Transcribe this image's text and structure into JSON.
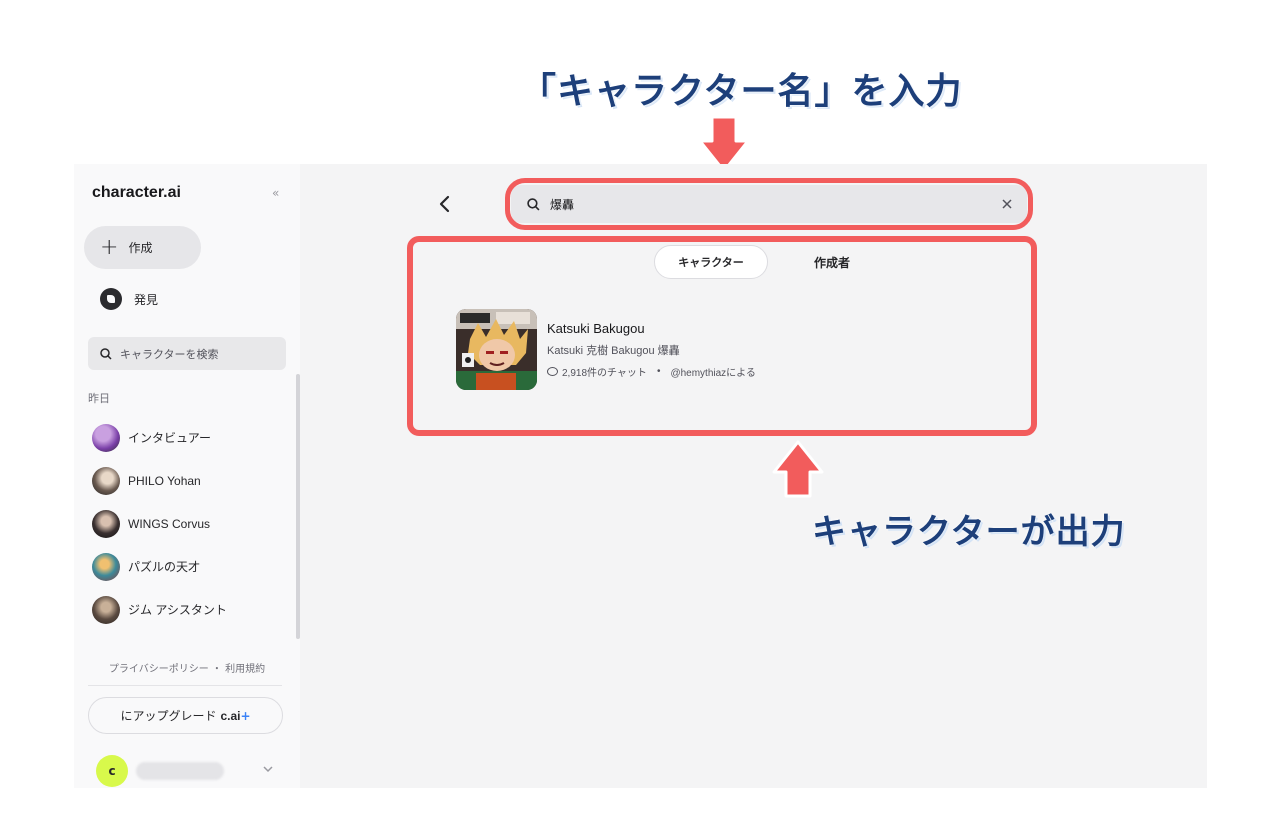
{
  "annotations": {
    "title": "「キャラクター名」を入力",
    "bottom": "キャラクターが出力"
  },
  "sidebar": {
    "logo": "character.ai",
    "collapse_icon": "«",
    "create_label": "作成",
    "discover_label": "発見",
    "search_placeholder": "キャラクターを検索",
    "section_label": "昨日",
    "chats": [
      {
        "name": "インタビュアー"
      },
      {
        "name": "PHILO Yohan"
      },
      {
        "name": "WINGS Corvus"
      },
      {
        "name": "パズルの天才"
      },
      {
        "name": "ジム アシスタント"
      }
    ],
    "footer": "プライバシーポリシー ・ 利用規約",
    "upgrade_prefix": "にアップグレード",
    "upgrade_brand": "c.ai",
    "upgrade_plus": "+",
    "user_initial": "c"
  },
  "main": {
    "search_value": "爆轟",
    "tabs": [
      {
        "label": "キャラクター",
        "active": true
      },
      {
        "label": "作成者",
        "active": false
      }
    ],
    "result": {
      "name": "Katsuki Bakugou",
      "description": "Katsuki 克樹 Bakugou 爆轟",
      "chats": "2,918件のチャット",
      "separator": "•",
      "creator": "@hemythiazによる"
    }
  },
  "colors": {
    "highlight": "#f25c5c",
    "annotation_text": "#1d3f7a",
    "accent_blue": "#3b82f6",
    "user_avatar": "#d8f94b"
  }
}
